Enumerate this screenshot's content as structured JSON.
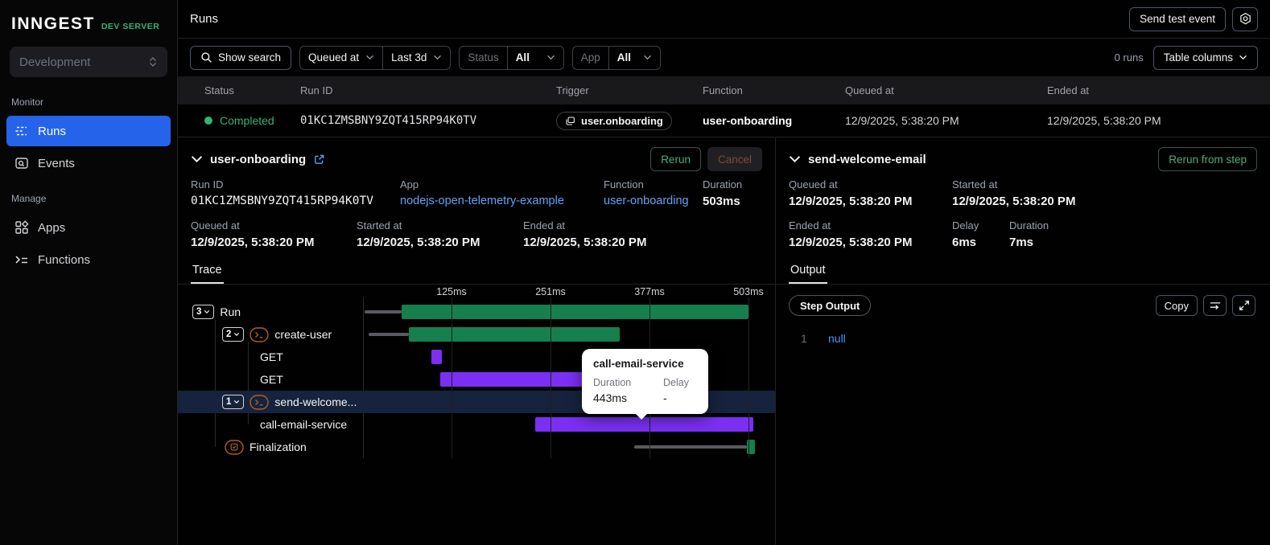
{
  "sidebar": {
    "logo": "INNGEST",
    "badge": "DEV SERVER",
    "environment": "Development",
    "monitor_label": "Monitor",
    "manage_label": "Manage",
    "items": {
      "runs": "Runs",
      "events": "Events",
      "apps": "Apps",
      "functions": "Functions"
    }
  },
  "topbar": {
    "title": "Runs",
    "send_test_event": "Send test event"
  },
  "filters": {
    "show_search": "Show search",
    "field": "Queued at",
    "range": "Last 3d",
    "status_label": "Status",
    "status_value": "All",
    "app_label": "App",
    "app_value": "All",
    "runs_count": "0 runs",
    "table_columns": "Table columns"
  },
  "table": {
    "columns": [
      "Status",
      "Run ID",
      "Trigger",
      "Function",
      "Queued at",
      "Ended at"
    ],
    "row": {
      "status": "Completed",
      "run_id": "01KC1ZMSBNY9ZQT415RP94K0TV",
      "trigger": "user.onboarding",
      "function": "user-onboarding",
      "queued_at": "12/9/2025, 5:38:20 PM",
      "ended_at": "12/9/2025, 5:38:20 PM"
    }
  },
  "run_panel": {
    "title": "user-onboarding",
    "rerun": "Rerun",
    "cancel": "Cancel",
    "run_id_label": "Run ID",
    "run_id": "01KC1ZMSBNY9ZQT415RP94K0TV",
    "app_label": "App",
    "app": "nodejs-open-telemetry-example",
    "function_label": "Function",
    "function": "user-onboarding",
    "duration_label": "Duration",
    "duration": "503ms",
    "queued_label": "Queued at",
    "queued": "12/9/2025, 5:38:20 PM",
    "started_label": "Started at",
    "started": "12/9/2025, 5:38:20 PM",
    "ended_label": "Ended at",
    "ended": "12/9/2025, 5:38:20 PM",
    "tab": "Trace"
  },
  "trace": {
    "total_ms": 503,
    "axis_ticks": [
      {
        "ms": 125,
        "label": "125ms"
      },
      {
        "ms": 251,
        "label": "251ms"
      },
      {
        "ms": 377,
        "label": "377ms"
      },
      {
        "ms": 503,
        "label": "503ms"
      }
    ],
    "rows": [
      {
        "name": "Run",
        "badge": "3",
        "indent": "root",
        "queue": [
          14,
          61
        ],
        "bar": [
          61,
          503
        ],
        "color": "green"
      },
      {
        "name": "create-user",
        "badge": "2",
        "icon": "step",
        "indent": "step",
        "queue": [
          19,
          71
        ],
        "bar": [
          71,
          339
        ],
        "color": "green"
      },
      {
        "name": "GET",
        "indent": "sub",
        "bar": [
          99,
          113
        ],
        "color": "purple"
      },
      {
        "name": "GET",
        "indent": "sub",
        "bar": [
          111,
          313
        ],
        "color": "purple"
      },
      {
        "name": "send-welcome...",
        "badge": "1",
        "icon": "step",
        "indent": "step",
        "bar": [
          346,
          365
        ],
        "color": "green",
        "highlighted": true
      },
      {
        "name": "call-email-service",
        "indent": "sub",
        "bar": [
          232,
          509
        ],
        "color": "purple"
      },
      {
        "name": "Finalization",
        "icon": "final",
        "indent": "final",
        "queue": [
          358,
          501
        ],
        "bar": [
          501,
          511
        ],
        "color": "green"
      }
    ]
  },
  "tooltip": {
    "title": "call-email-service",
    "duration_label": "Duration",
    "duration": "443ms",
    "delay_label": "Delay",
    "delay": "-"
  },
  "step_panel": {
    "title": "send-welcome-email",
    "rerun_from_step": "Rerun from step",
    "queued_label": "Queued at",
    "queued": "12/9/2025, 5:38:20 PM",
    "started_label": "Started at",
    "started": "12/9/2025, 5:38:20 PM",
    "ended_label": "Ended at",
    "ended": "12/9/2025, 5:38:20 PM",
    "delay_label": "Delay",
    "delay": "6ms",
    "duration_label": "Duration",
    "duration": "7ms",
    "tab": "Output",
    "output_badge": "Step Output",
    "copy": "Copy",
    "line_number": "1",
    "value": "null"
  },
  "colors": {
    "green": "#15804d",
    "purple": "#7a2ff2",
    "queue_gray": "#5a5a61",
    "highlight_row": "#16233c",
    "accent_blue": "#2563eb",
    "status_green": "#2fb575",
    "link_blue": "#66a3f5",
    "step_icon_orange": "#b05c28"
  }
}
